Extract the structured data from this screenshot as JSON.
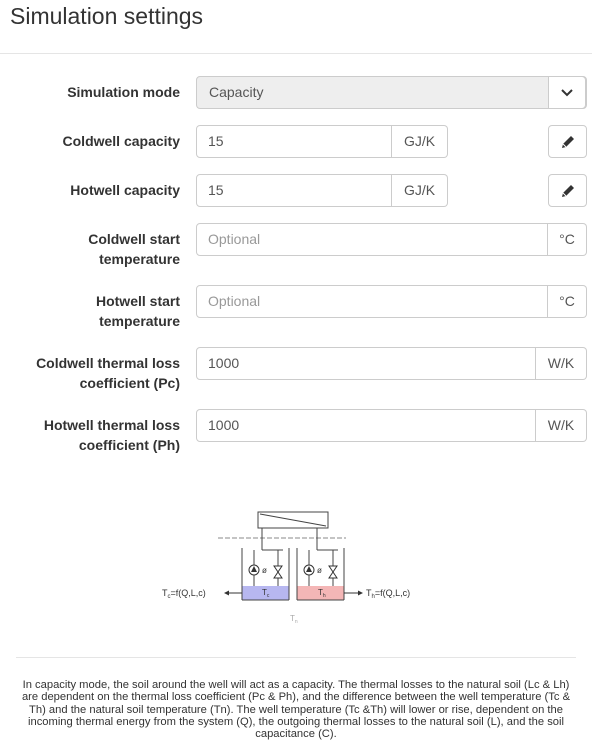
{
  "page": {
    "title": "Simulation settings"
  },
  "form": {
    "mode": {
      "label": "Simulation mode",
      "value": "Capacity"
    },
    "coldwell_capacity": {
      "label": "Coldwell capacity",
      "value": "15",
      "unit": "GJ/K"
    },
    "hotwell_capacity": {
      "label": "Hotwell capacity",
      "value": "15",
      "unit": "GJ/K"
    },
    "coldwell_start": {
      "label_line1": "Coldwell start",
      "label_line2": "temperature",
      "placeholder": "Optional",
      "unit": "°C"
    },
    "hotwell_start": {
      "label_line1": "Hotwell start",
      "label_line2": "temperature",
      "placeholder": "Optional",
      "unit": "°C"
    },
    "coldwell_loss": {
      "label_line1": "Coldwell thermal loss",
      "label_line2": "coefficient (Pc)",
      "value": "1000",
      "unit": "W/K"
    },
    "hotwell_loss": {
      "label_line1": "Hotwell thermal loss",
      "label_line2": "coefficient (Ph)",
      "value": "1000",
      "unit": "W/K"
    }
  },
  "diagram": {
    "tc_formula": "T",
    "tc_sub": "c",
    "tc_rest": "=f(Q,L,c)",
    "th_formula": "T",
    "th_sub": "h",
    "th_rest": "=f(Q,L,c)",
    "tc_label": "T",
    "tc_label_sub": "c",
    "th_label": "T",
    "th_label_sub": "h",
    "tn_label": "T",
    "tn_label_sub": "n",
    "colors": {
      "cold": "#b7b7f0",
      "hot": "#f4b6b6",
      "line": "#444444"
    }
  },
  "description": "In capacity mode, the soil around the well will act as a capacity. The thermal losses to the natural soil (Lc & Lh) are dependent on the thermal loss coefficient (Pc & Ph), and the difference between the well temperature (Tc & Th) and the natural soil temperature (Tn). The well temperature (Tc &Th) will lower or rise, dependent on the incoming thermal energy from the system (Q), the outgoing thermal losses to the natural soil (L), and the soil capacitance (C)."
}
